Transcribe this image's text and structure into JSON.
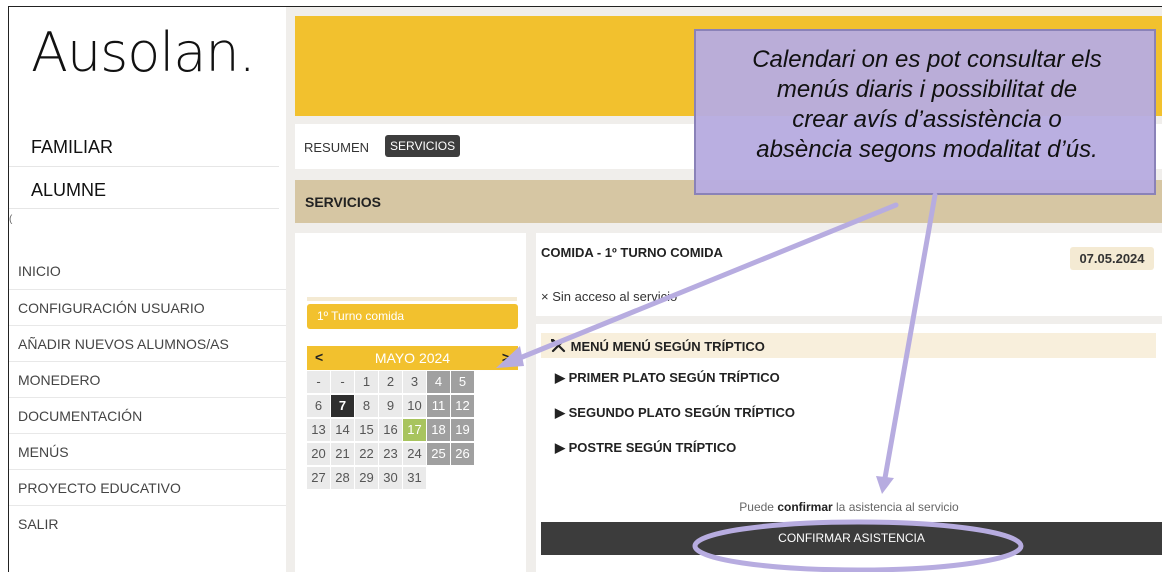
{
  "brand": {
    "logo_text": "Ausolan."
  },
  "sidebar": {
    "role_familiar": "FAMILIAR",
    "role_alumne": "ALUMNE",
    "role_extra": "(",
    "items": [
      {
        "label": "INICIO"
      },
      {
        "label": "CONFIGURACIÓN USUARIO"
      },
      {
        "label": "AÑADIR NUEVOS ALUMNOS/AS"
      },
      {
        "label": "MONEDERO"
      },
      {
        "label": "DOCUMENTACIÓN"
      },
      {
        "label": "MENÚS"
      },
      {
        "label": "PROYECTO EDUCATIVO"
      },
      {
        "label": "SALIR"
      }
    ]
  },
  "tabs": {
    "resumen": "RESUMEN",
    "servicios": "SERVICIOS"
  },
  "section": {
    "title": "SERVICIOS"
  },
  "calendar": {
    "turno": "1º Turno comida",
    "prev": "<",
    "month": "MAYO 2024",
    "next": ">",
    "rows": [
      [
        "-",
        "-",
        "1",
        "2",
        "3",
        "4",
        "5"
      ],
      [
        "6",
        "7",
        "8",
        "9",
        "10",
        "11",
        "12"
      ],
      [
        "13",
        "14",
        "15",
        "16",
        "17",
        "18",
        "19"
      ],
      [
        "20",
        "21",
        "22",
        "23",
        "24",
        "25",
        "26"
      ],
      [
        "27",
        "28",
        "29",
        "30",
        "31",
        "",
        ""
      ]
    ],
    "selected_day": "7",
    "today": "17",
    "colors": {
      "accent": "#f2c12e",
      "weekend": "#a0a0a0",
      "selected": "#2f2f2f",
      "today": "#a8c45e"
    }
  },
  "service": {
    "title": "COMIDA - 1º TURNO COMIDA",
    "date": "07.05.2024",
    "status_icon": "×",
    "status": "Sin acceso al servicio"
  },
  "menu": {
    "title": "MENÚ MENÚ SEGÚN TRÍPTICO",
    "title_icon": "utensils-icon",
    "dishes": [
      {
        "label": "PRIMER PLATO SEGÚN TRÍPTICO"
      },
      {
        "label": "SEGUNDO PLATO SEGÚN TRÍPTICO"
      },
      {
        "label": "POSTRE SEGÚN TRÍPTICO"
      }
    ],
    "confirm_prefix": "Puede",
    "confirm_bold": "confirmar",
    "confirm_suffix": "la asistencia al servicio",
    "confirm_button": "CONFIRMAR ASISTENCIA"
  },
  "annotation": {
    "line1": "Calendari on es pot consultar els",
    "line2": "menús diaris i possibilitat de",
    "line3": "crear avís d’assistència o",
    "line4": "absència segons modalitat d’ús."
  },
  "colors": {
    "brand_yellow": "#f2c12e",
    "section_tan": "#d6c6a3",
    "annotation_purple": "#b7ace0",
    "dark_button": "#3c3c3c"
  }
}
